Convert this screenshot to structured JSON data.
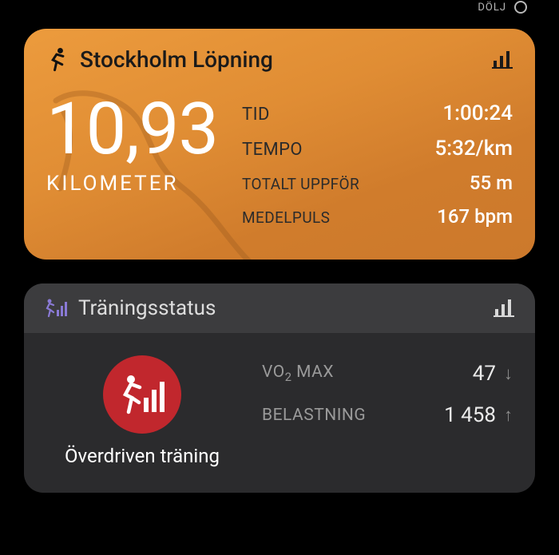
{
  "topRight": {
    "label": "DÖLJ"
  },
  "activity": {
    "title": "Stockholm Löpning",
    "distance": {
      "value": "10,93",
      "unit": "KILOMETER"
    },
    "stats": {
      "time": {
        "label": "TID",
        "value": "1:00:24"
      },
      "pace": {
        "label": "TEMPO",
        "value": "5:32/km"
      },
      "ascent": {
        "label": "TOTALT UPPFÖR",
        "value": "55 m"
      },
      "avghr": {
        "label": "MEDELPULS",
        "value": "167 bpm"
      }
    }
  },
  "status": {
    "title": "Träningsstatus",
    "badge": "Överdriven träning",
    "metrics": {
      "vo2max": {
        "label": "VO₂ MAX",
        "value": "47",
        "trend": "down"
      },
      "load": {
        "label": "BELASTNING",
        "value": "1 458",
        "trend": "up"
      }
    }
  },
  "icons": {
    "runner": "runner-icon",
    "bars": "bars-icon",
    "runnerBars": "runner-bars-icon",
    "circle": "circle-icon",
    "arrowDown": "↓",
    "arrowUp": "↑"
  }
}
